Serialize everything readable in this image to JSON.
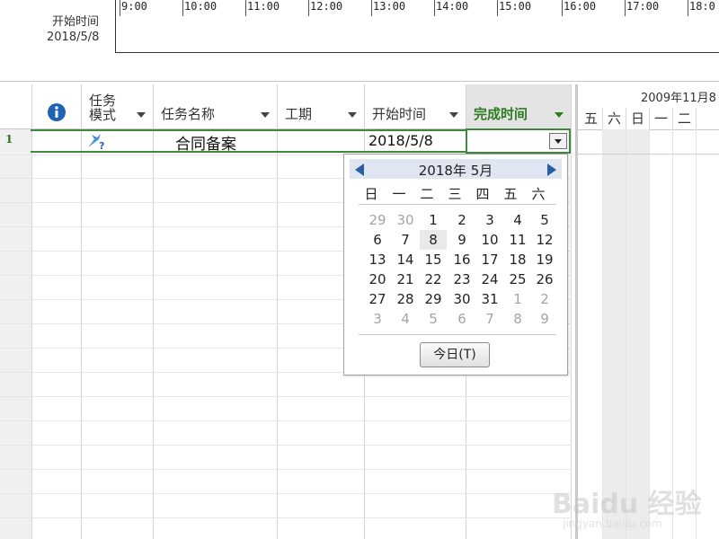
{
  "timeline": {
    "start_label": "开始时间",
    "start_date": "2018/5/8",
    "hours": [
      "9:00",
      "10:00",
      "11:00",
      "12:00",
      "13:00",
      "14:00",
      "15:00",
      "16:00",
      "17:00",
      "18:0"
    ]
  },
  "columns": {
    "info_icon": "info-icon",
    "mode_line1": "任务",
    "mode_line2": "模式",
    "name": "任务名称",
    "duration": "工期",
    "start": "开始时间",
    "finish": "完成时间"
  },
  "rows": [
    {
      "num": "1",
      "mode_icon": "manual-task-icon",
      "name": "合同备案",
      "duration": "",
      "start": "2018/5/8",
      "finish": ""
    }
  ],
  "gantt": {
    "header_date": "2009年11月8",
    "days": [
      "五",
      "六",
      "日",
      "一",
      "二"
    ]
  },
  "date_picker": {
    "title": "2018年 5月",
    "weekdays": [
      "日",
      "一",
      "二",
      "三",
      "四",
      "五",
      "六"
    ],
    "weeks": [
      [
        {
          "d": "29",
          "o": true
        },
        {
          "d": "30",
          "o": true
        },
        {
          "d": "1"
        },
        {
          "d": "2"
        },
        {
          "d": "3"
        },
        {
          "d": "4"
        },
        {
          "d": "5"
        }
      ],
      [
        {
          "d": "6"
        },
        {
          "d": "7"
        },
        {
          "d": "8",
          "sel": true
        },
        {
          "d": "9"
        },
        {
          "d": "10"
        },
        {
          "d": "11"
        },
        {
          "d": "12"
        }
      ],
      [
        {
          "d": "13"
        },
        {
          "d": "14"
        },
        {
          "d": "15"
        },
        {
          "d": "16"
        },
        {
          "d": "17"
        },
        {
          "d": "18"
        },
        {
          "d": "19"
        }
      ],
      [
        {
          "d": "20"
        },
        {
          "d": "21"
        },
        {
          "d": "22"
        },
        {
          "d": "23"
        },
        {
          "d": "24"
        },
        {
          "d": "25"
        },
        {
          "d": "26"
        }
      ],
      [
        {
          "d": "27"
        },
        {
          "d": "28"
        },
        {
          "d": "29"
        },
        {
          "d": "30"
        },
        {
          "d": "31"
        },
        {
          "d": "1",
          "o": true
        },
        {
          "d": "2",
          "o": true
        }
      ],
      [
        {
          "d": "3",
          "o": true
        },
        {
          "d": "4",
          "o": true
        },
        {
          "d": "5",
          "o": true
        },
        {
          "d": "6",
          "o": true
        },
        {
          "d": "7",
          "o": true
        },
        {
          "d": "8",
          "o": true
        },
        {
          "d": "9",
          "o": true
        }
      ]
    ],
    "today_label": "今日(T)"
  },
  "watermark": {
    "text": "Baidu 经验",
    "sub": "jingyan.baidu.com"
  },
  "colors": {
    "accent_green": "#3d8a3b",
    "finish_header": "#2f7a22",
    "nav_blue": "#2a5fa8",
    "info_blue": "#1f63b5"
  }
}
